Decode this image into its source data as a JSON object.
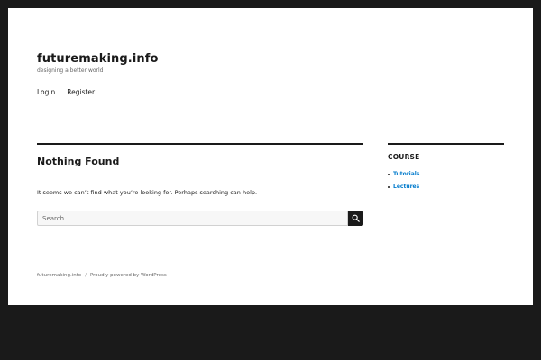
{
  "header": {
    "site_title": "futuremaking.info",
    "site_description": "designing a better world"
  },
  "nav": {
    "items": [
      {
        "label": "Login"
      },
      {
        "label": "Register"
      }
    ]
  },
  "main": {
    "page_title": "Nothing Found",
    "message": "It seems we can’t find what you’re looking for. Perhaps searching can help.",
    "search": {
      "placeholder": "Search …",
      "value": "",
      "submit_icon": "search-icon"
    }
  },
  "sidebar": {
    "widget_title": "COURSE",
    "items": [
      {
        "label": "Tutorials"
      },
      {
        "label": "Lectures"
      }
    ]
  },
  "footer": {
    "site_link": "futuremaking.info",
    "separator": "/",
    "powered_by": "Proudly powered by WordPress"
  },
  "colors": {
    "background": "#1a1a1a",
    "page": "#ffffff",
    "text": "#1a1a1a",
    "muted": "#686868",
    "link": "#007acc"
  }
}
